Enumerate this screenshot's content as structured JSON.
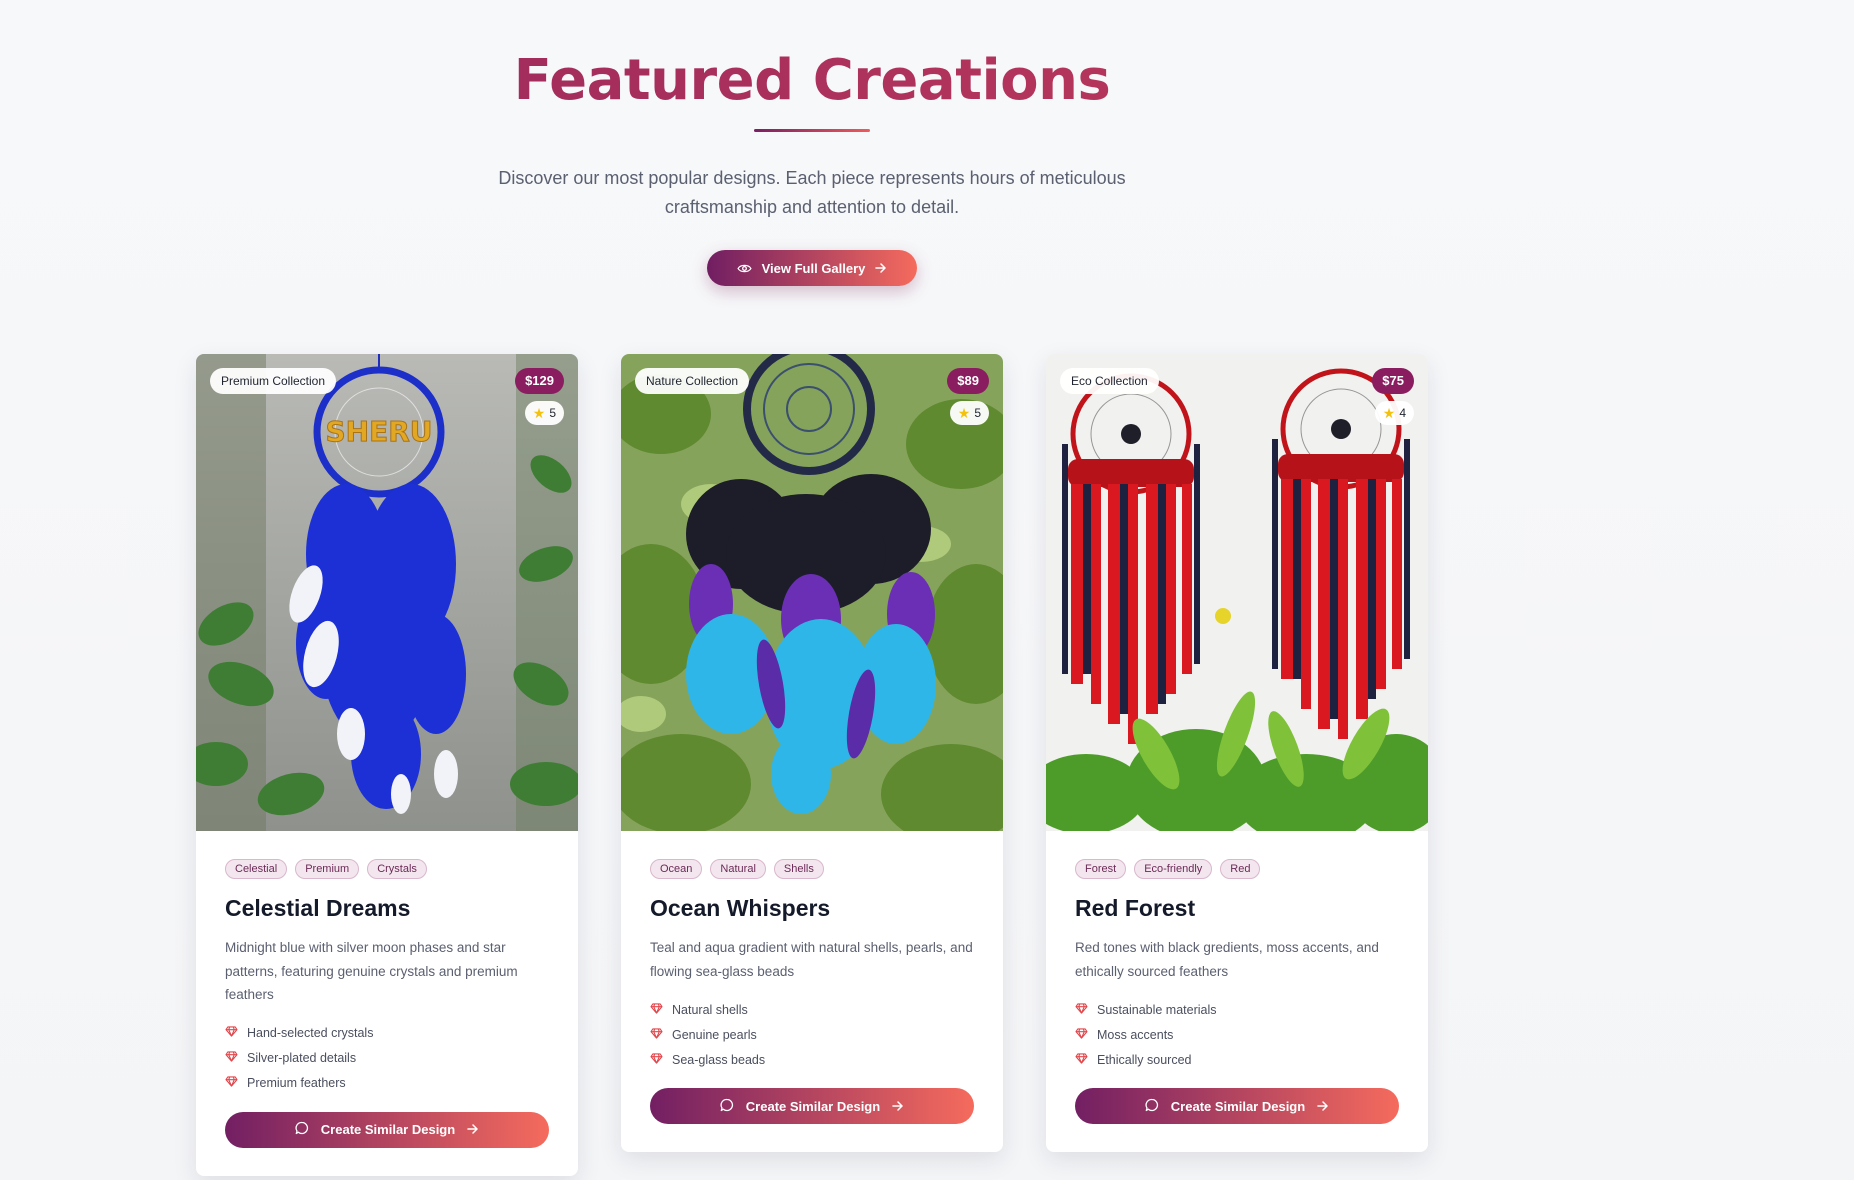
{
  "section": {
    "title": "Featured Creations",
    "subtitle": "Discover our most popular designs. Each piece represents hours of meticulous craftsmanship and attention to detail.",
    "gallery_button": "View Full Gallery"
  },
  "colors": {
    "brand_dark": "#701e62",
    "brand_light": "#f56b5d",
    "price_badge": "#8a1d5f",
    "feature_icon": "#e0474c"
  },
  "cards": [
    {
      "collection": "Premium Collection",
      "price": "$129",
      "rating": "5",
      "tags": [
        "Celestial",
        "Premium",
        "Crystals"
      ],
      "title": "Celestial Dreams",
      "description": "Midnight blue with silver moon phases and star patterns, featuring genuine crystals and premium feathers",
      "features": [
        "Hand-selected crystals",
        "Silver-plated details",
        "Premium feathers"
      ],
      "button": "Create Similar Design",
      "image_label": "SHERU"
    },
    {
      "collection": "Nature Collection",
      "price": "$89",
      "rating": "5",
      "tags": [
        "Ocean",
        "Natural",
        "Shells"
      ],
      "title": "Ocean Whispers",
      "description": "Teal and aqua gradient with natural shells, pearls, and flowing sea-glass beads",
      "features": [
        "Natural shells",
        "Genuine pearls",
        "Sea-glass beads"
      ],
      "button": "Create Similar Design"
    },
    {
      "collection": "Eco Collection",
      "price": "$75",
      "rating": "4",
      "tags": [
        "Forest",
        "Eco-friendly",
        "Red"
      ],
      "title": "Red Forest",
      "description": "Red tones with black gredients, moss accents, and ethically sourced feathers",
      "features": [
        "Sustainable materials",
        "Moss accents",
        "Ethically sourced"
      ],
      "button": "Create Similar Design"
    }
  ],
  "icons": {
    "gallery_button": "eye-icon",
    "arrow": "arrow-right-icon",
    "create_button": "chat-bubble-icon",
    "feature": "gem-icon",
    "rating": "star-icon"
  }
}
